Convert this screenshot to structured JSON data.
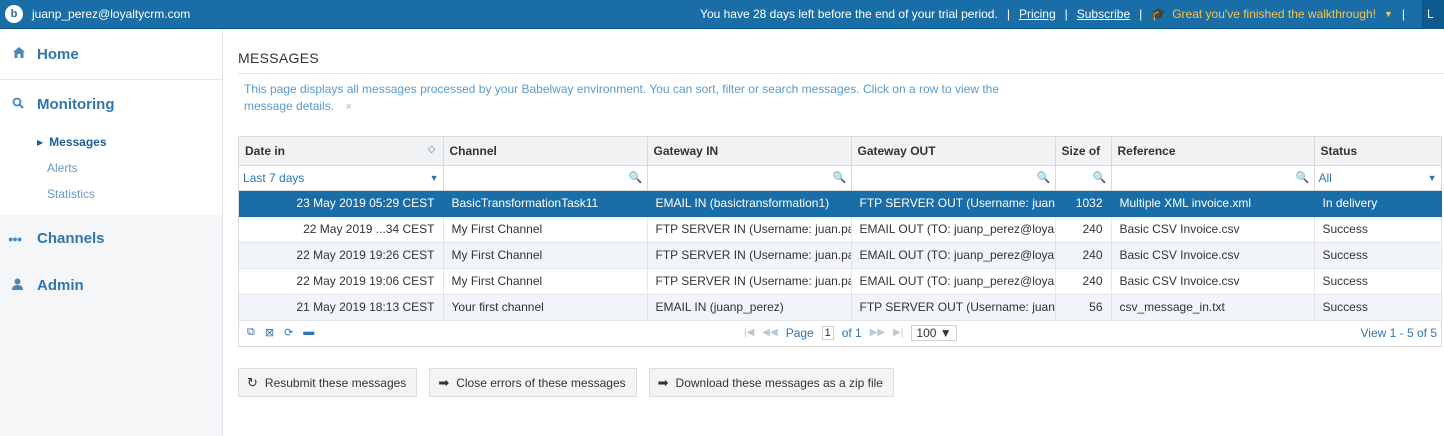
{
  "topbar": {
    "user_email": "juanp_perez@loyaltycrm.com",
    "trial_text": "You have 28 days left before the end of your trial period.",
    "sep": "|",
    "pricing": "Pricing",
    "subscribe": "Subscribe",
    "walkthrough": "Great you've finished the walkthrough!",
    "login_cut": "L"
  },
  "sidebar": {
    "home": "Home",
    "monitoring": "Monitoring",
    "messages": "Messages",
    "alerts": "Alerts",
    "statistics": "Statistics",
    "channels": "Channels",
    "admin": "Admin"
  },
  "main": {
    "title": "MESSAGES",
    "info": "This page displays all messages processed by your Babelway environment. You can sort, filter or search messages. Click on a row to view the message details.",
    "close": "×"
  },
  "grid": {
    "headers": [
      "Date in",
      "Channel",
      "Gateway IN",
      "Gateway OUT",
      "Size of",
      "Reference",
      "Status"
    ],
    "filter_date": "Last 7 days",
    "filter_status": "All",
    "rows": [
      [
        "23 May 2019 05:29 CEST",
        "BasicTransformationTask11",
        "EMAIL IN (basictransformation1)",
        "FTP SERVER OUT (Username: juan",
        "1032",
        "Multiple XML invoice.xml",
        "In delivery"
      ],
      [
        "22 May 2019 ...34 CEST",
        "My First Channel",
        "FTP SERVER IN (Username: juan.pa",
        "EMAIL OUT (TO: juanp_perez@loya",
        "240",
        "Basic CSV Invoice.csv",
        "Success"
      ],
      [
        "22 May 2019 19:26 CEST",
        "My First Channel",
        "FTP SERVER IN (Username: juan.pa",
        "EMAIL OUT (TO: juanp_perez@loya",
        "240",
        "Basic CSV Invoice.csv",
        "Success"
      ],
      [
        "22 May 2019 19:06 CEST",
        "My First Channel",
        "FTP SERVER IN (Username: juan.pa",
        "EMAIL OUT (TO: juanp_perez@loya",
        "240",
        "Basic CSV Invoice.csv",
        "Success"
      ],
      [
        "21 May 2019 18:13 CEST",
        "Your first channel",
        "EMAIL IN (juanp_perez)",
        "FTP SERVER OUT (Username: juan",
        "56",
        "csv_message_in.txt",
        "Success"
      ]
    ],
    "pager": {
      "page_label": "Page",
      "page_value": "1",
      "of_label": "of 1",
      "rows_per_page": "100",
      "view": "View 1 - 5 of 5"
    }
  },
  "actions": {
    "resubmit": "Resubmit these messages",
    "close_errors": "Close errors of these messages",
    "download": "Download these messages as a zip file"
  }
}
